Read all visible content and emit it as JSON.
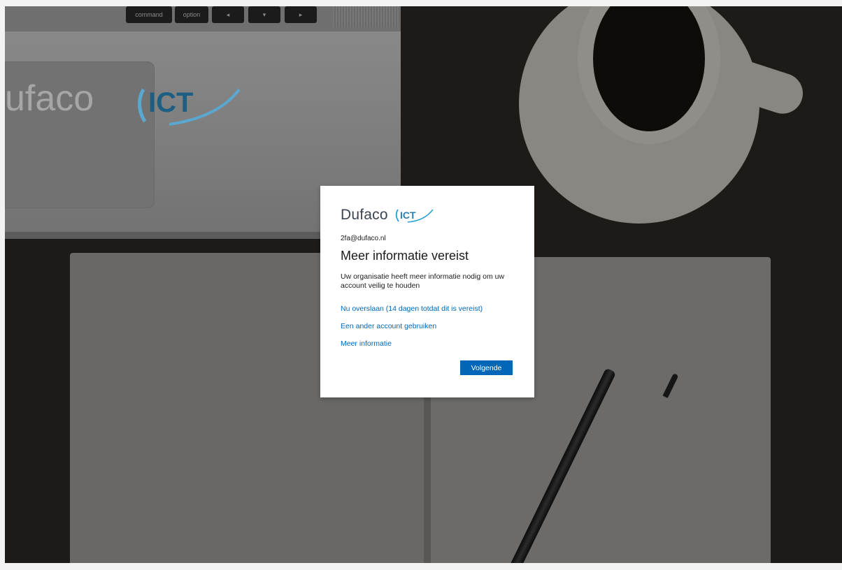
{
  "dialog": {
    "brand_name": "Dufaco",
    "brand_ict": "ICT",
    "account_email": "2fa@dufaco.nl",
    "title": "Meer informatie vereist",
    "description": "Uw organisatie heeft meer informatie nodig om uw account veilig te houden",
    "links": {
      "skip": "Nu overslaan (14 dagen totdat dit is vereist)",
      "other_account": "Een ander account gebruiken",
      "more_info": "Meer informatie"
    },
    "next_label": "Volgende"
  },
  "background": {
    "laptop_logo_text": "ufaco",
    "laptop_logo_ict": "ICT",
    "keys": [
      "command",
      "option",
      "◂",
      "▾",
      "▸"
    ]
  },
  "colors": {
    "link": "#0067b8",
    "primary_button": "#0067b8",
    "brand_text": "#3c4450",
    "brand_accent": "#2a9fd6"
  }
}
